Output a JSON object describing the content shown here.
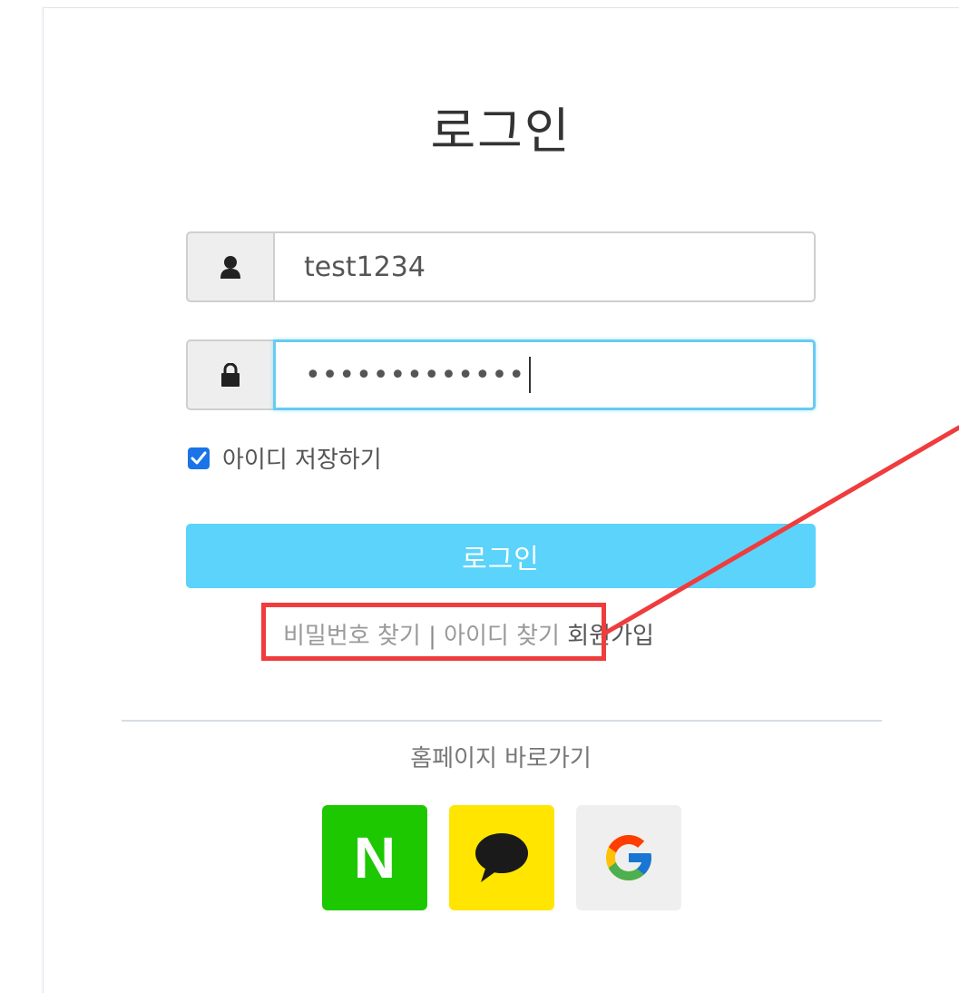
{
  "title": "로그인",
  "username": {
    "value": "test1234",
    "icon": "user-icon"
  },
  "password": {
    "masked_value": "•••••••••••••",
    "icon": "lock-icon"
  },
  "remember": {
    "label": "아이디 저장하기",
    "checked": true
  },
  "login_button": {
    "label": "로그인",
    "color": "#5bd3fb"
  },
  "links": {
    "find_password": "비밀번호 찾기",
    "separator": "|",
    "find_id": "아이디 찾기",
    "signup": "회원가입"
  },
  "homepage": {
    "label": "홈페이지 바로가기"
  },
  "social": [
    {
      "name": "naver",
      "glyph": "N",
      "color": "#1ec800"
    },
    {
      "name": "kakao",
      "icon": "kakao-chat-icon",
      "color": "#ffe500"
    },
    {
      "name": "google",
      "icon": "google-icon",
      "color": "#efefef"
    }
  ],
  "annotation": {
    "color": "#f03c3c"
  }
}
